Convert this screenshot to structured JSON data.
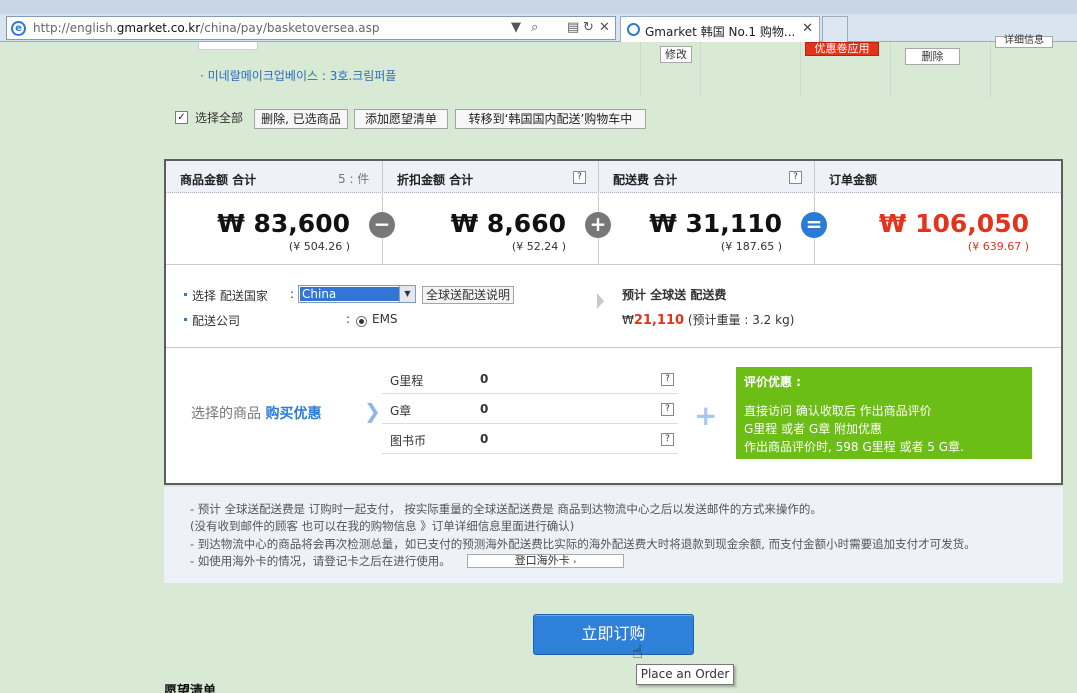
{
  "browser": {
    "url_prefix": "http://english.",
    "url_domain": "gmarket.co.kr",
    "url_path": "/china/pay/basketoversea.asp",
    "tab_title": "Gmarket 韩国 No.1 购物...",
    "tab_close": "✕"
  },
  "prev_item": {
    "name": "· 미네랄메이크업베이스 : 3호.크림퍼플",
    "modify_label": "修改",
    "coupon_label": "优惠卷应用",
    "delete_label": "删除",
    "detail_label": "详细信息"
  },
  "actions": {
    "select_all": "选择全部",
    "delete_selected": "删除, 已选商品",
    "add_wishlist": "添加愿望清单",
    "move_domestic": "转移到‘韩国国内配送’购物车中"
  },
  "summary": {
    "goods": {
      "label": "商品金额 合计",
      "count": "5 : 件",
      "amount": "₩ 83,600",
      "sub": "(¥ 504.26 )"
    },
    "discount": {
      "label": "折扣金额 合计",
      "amount": "₩ 8,660",
      "sub": "(¥ 52.24 )"
    },
    "shipping": {
      "label": "配送费 合计",
      "amount": "₩ 31,110",
      "sub": "(¥ 187.65 )"
    },
    "order": {
      "label": "订单金额",
      "amount": "₩ 106,050",
      "sub": "(¥ 639.67 )"
    },
    "op_minus": "−",
    "op_plus": "+",
    "op_eq": "=",
    "help": "?"
  },
  "shipping_form": {
    "country_label": "选择 配送国家",
    "colon": ":",
    "country_value": "China",
    "intl_info_button": "全球送配送说明",
    "company_label": "配送公司",
    "company_value": "EMS",
    "est_title": "预计 全球送 配送费",
    "est_currency": "₩",
    "est_amount": "21,110",
    "est_weight": "(预计重量 : 3.2 kg)",
    "colors": {
      "blue": "#2a7bd6",
      "red": "#e4321b"
    }
  },
  "benefits": {
    "label_a": "选择的商品",
    "label_b": "购买优惠",
    "rows": [
      {
        "name": "G里程",
        "value": "0"
      },
      {
        "name": "G章",
        "value": "0"
      },
      {
        "name": "图书币",
        "value": "0"
      }
    ],
    "review_title": "评价优惠 :",
    "review_lines": [
      "直接访问 确认收取后 作出商品评价",
      "G里程 或者 G章 附加优惠",
      "作出商品评价时, 598 G里程 或者 5 G章."
    ],
    "green": "#6dbd17"
  },
  "notes": {
    "lines": [
      "- 预计 全球送配送费是 订购时一起支付，  按实际重量的全球送配送费是 商品到达物流中心之后以发送邮件的方式来操作的。",
      "(没有收到邮件的顾客 也可以在我的购物信息 》订单详细信息里面进行确认)",
      "- 到达物流中心的商品将会再次检测总量，如已支付的预测海外配送费比实际的海外配送费大时将退款到现金余额, 而支付金额小时需要追加支付才可发货。",
      "- 如使用海外卡的情况，请登记卡之后在进行使用。"
    ],
    "card_button": "登口海外卡"
  },
  "order_button": "立即订购",
  "tooltip": "Place an Order",
  "wishlist_title": "愿望清单"
}
